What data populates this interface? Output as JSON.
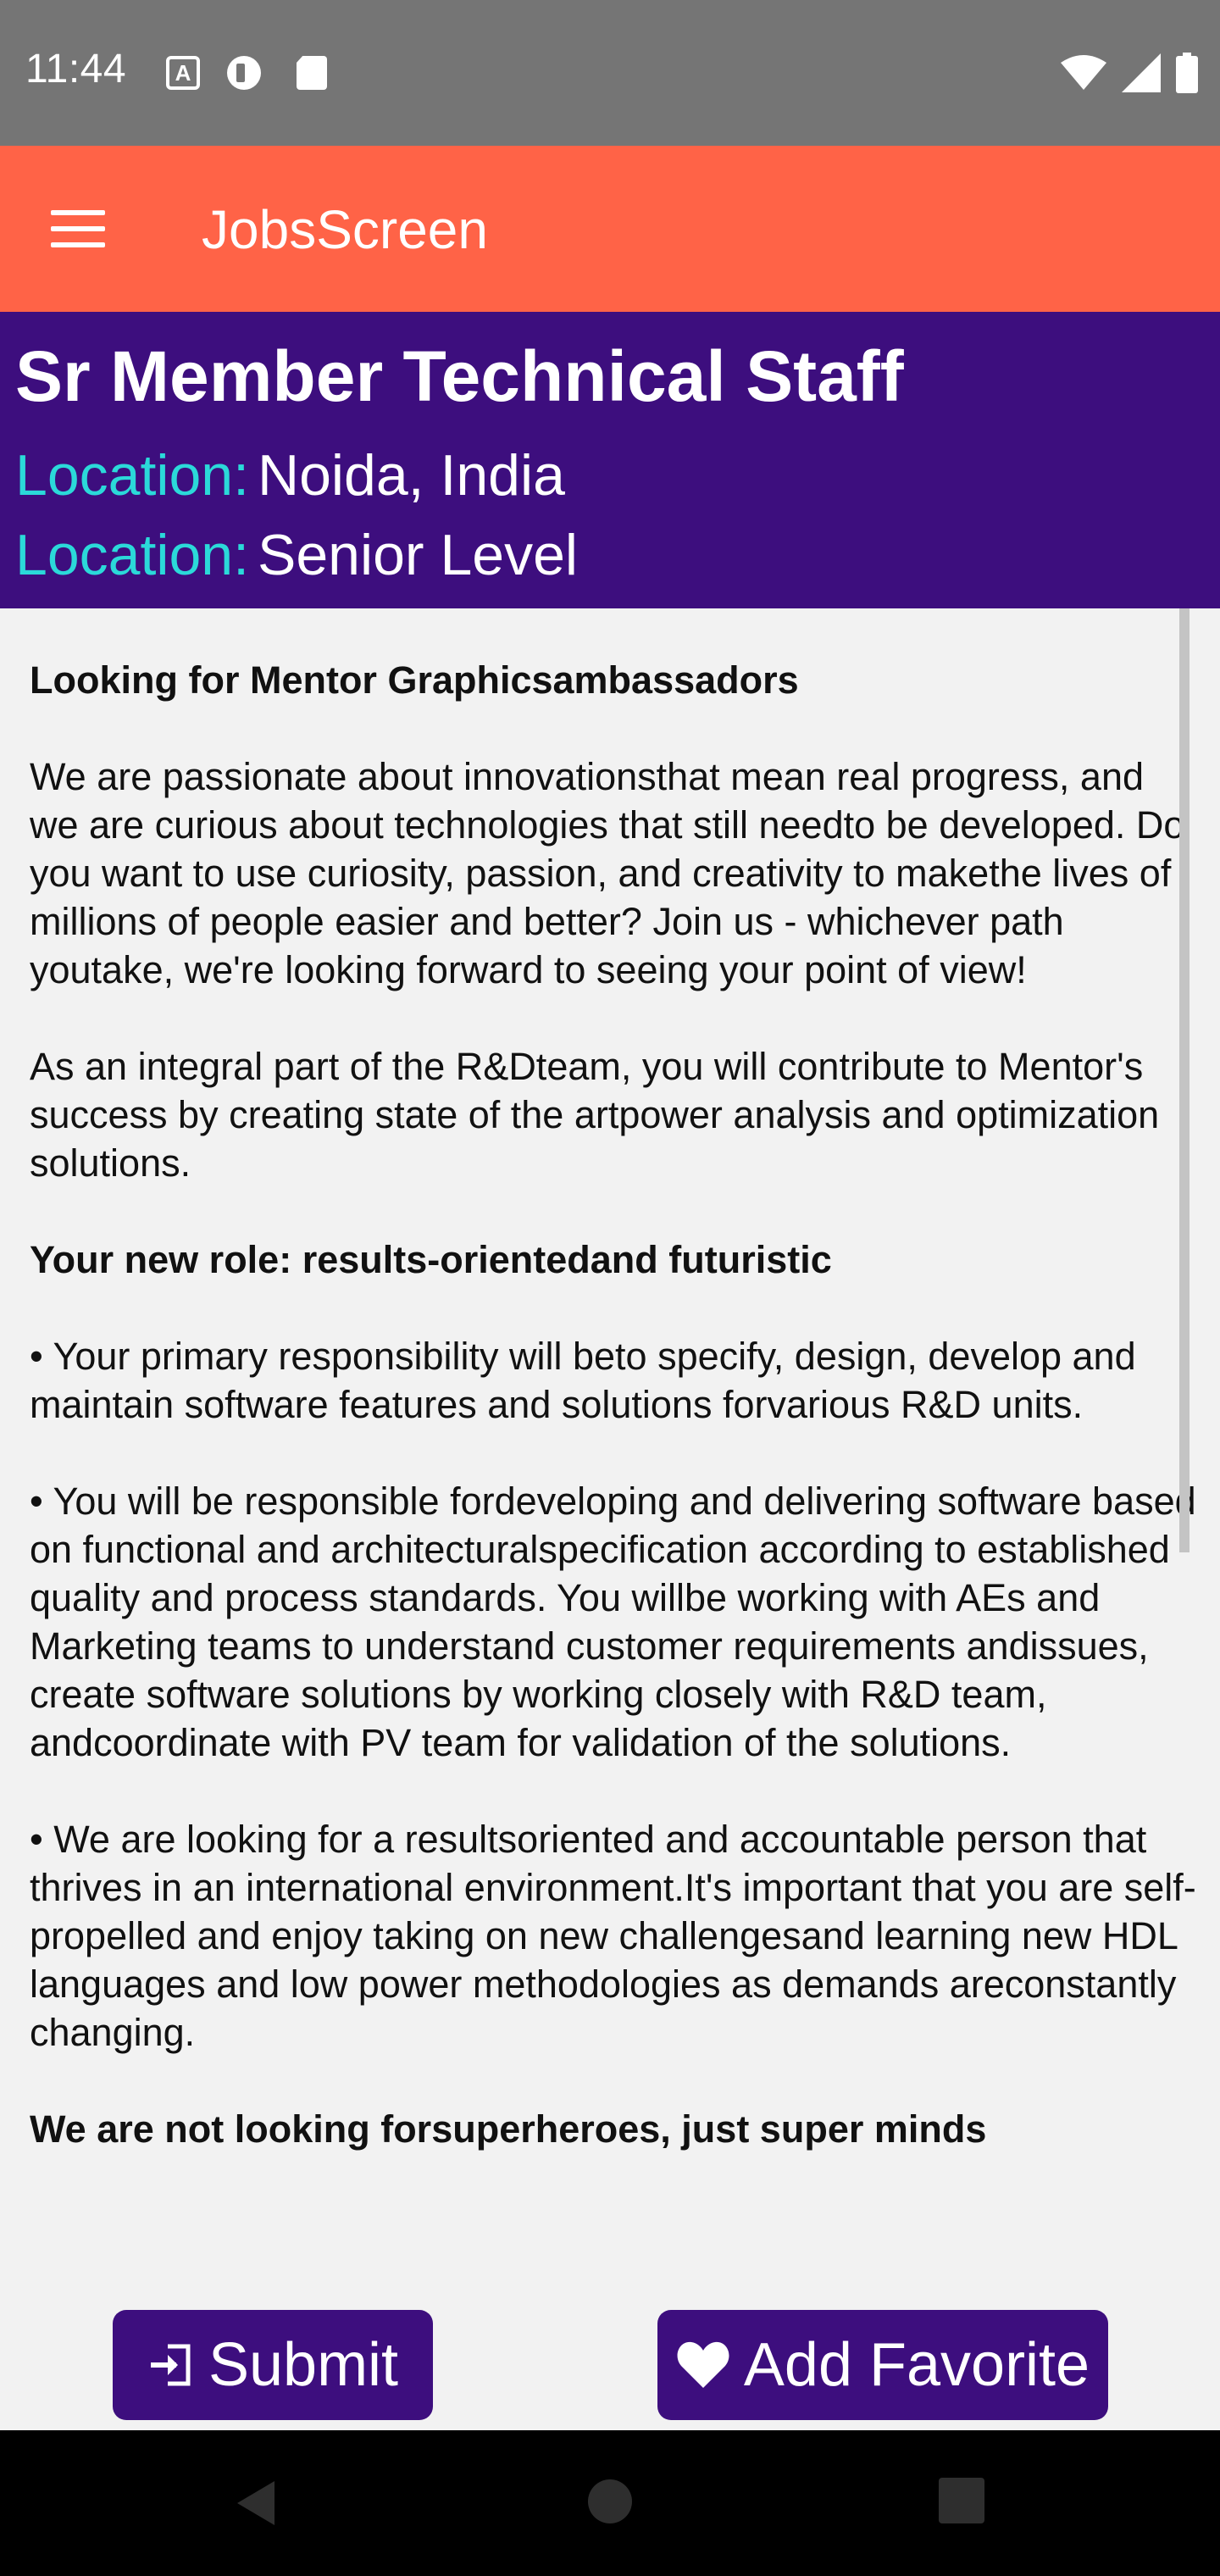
{
  "status_bar": {
    "time": "11:44",
    "left_icons": [
      "accessibility-icon",
      "pocket-icon",
      "sd-card-icon"
    ],
    "right_icons": [
      "wifi-icon",
      "signal-icon",
      "battery-icon"
    ]
  },
  "app_bar": {
    "title": "JobsScreen",
    "menu_icon": "menu-icon",
    "color": "#ff6347"
  },
  "job": {
    "title": "Sr Member Technical Staff",
    "location_label": "Location:",
    "location_value": "Noida, India",
    "level_label": "Location:",
    "level_value": "Senior Level",
    "header_color": "#3d0e7e",
    "label_color": "#2bd9d9"
  },
  "description": {
    "heading1": "Looking for Mentor Graphicsambassadors",
    "para1": "We are passionate about innovationsthat mean real progress, and we are curious about technologies that still needto be developed. Do you want to use curiosity, passion, and creativity to makethe lives of millions of people easier and better? Join us - whichever path youtake, we're looking forward to seeing your point of view!",
    "para2": "As an integral part of the R&Dteam, you will contribute to Mentor's success by creating state of the artpower analysis and optimization solutions.",
    "heading2": "Your new role: results-orientedand futuristic",
    "bullet1": "• Your primary responsibility will beto specify, design, develop and maintain software features and solutions forvarious R&D units.",
    "bullet2": "• You will be responsible fordeveloping and delivering software based on functional and architecturalspecification according to established quality and process standards. You willbe working with AEs and Marketing teams to understand customer requirements andissues, create software solutions by working closely with R&D team, andcoordinate with PV team for validation of the solutions.",
    "bullet3": "• We are looking for a resultsoriented and accountable person that thrives in an international environment.It's important that you are self-propelled and enjoy taking on new challengesand learning new HDL languages and low power methodologies as demands areconstantly changing.",
    "heading3": "We are not looking forsuperheroes, just super minds"
  },
  "actions": {
    "submit_label": "Submit",
    "favorite_label": "Add Favorite",
    "submit_icon": "sign-in-icon",
    "favorite_icon": "heart-icon"
  },
  "nav_bar": {
    "icons": [
      "back-icon",
      "home-icon",
      "recents-icon"
    ]
  }
}
